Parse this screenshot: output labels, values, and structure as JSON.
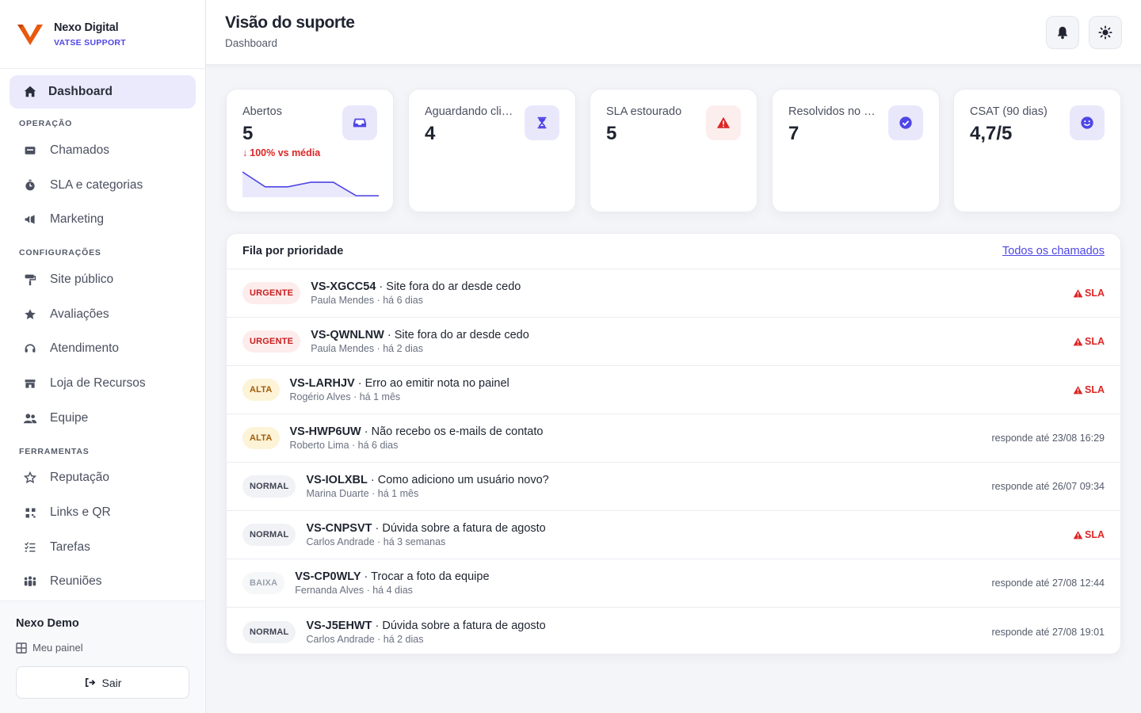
{
  "brand": {
    "name": "Nexo Digital",
    "subtitle": "VATSE SUPPORT",
    "logo_color": "#e8590c"
  },
  "sidebar": {
    "dashboard_label": "Dashboard",
    "sections": {
      "operacao": "OPERAÇÃO",
      "configuracoes": "CONFIGURAÇÕES",
      "ferramentas": "FERRAMENTAS"
    },
    "items": {
      "chamados": "Chamados",
      "sla": "SLA e categorias",
      "marketing": "Marketing",
      "site": "Site público",
      "avaliacoes": "Avaliações",
      "atendimento": "Atendimento",
      "loja": "Loja de Recursos",
      "equipe": "Equipe",
      "reputacao": "Reputação",
      "links": "Links e QR",
      "tarefas": "Tarefas",
      "reunioes": "Reuniões"
    },
    "footer": {
      "user_name": "Nexo Demo",
      "my_panel": "Meu painel",
      "logout": "Sair"
    }
  },
  "header": {
    "title": "Visão do suporte",
    "breadcrumb": "Dashboard"
  },
  "stats": [
    {
      "label": "Abertos",
      "value": "5",
      "trend": "100% vs média",
      "icon": "inbox-icon"
    },
    {
      "label": "Aguardando cliente",
      "value": "4",
      "icon": "hourglass-icon"
    },
    {
      "label": "SLA estourado",
      "value": "5",
      "icon": "warning-icon"
    },
    {
      "label": "Resolvidos no período",
      "value": "7",
      "icon": "check-circle-icon"
    },
    {
      "label": "CSAT (90 dias)",
      "value": "4,7/5",
      "icon": "smile-icon"
    }
  ],
  "sparkline": {
    "values": [
      3,
      2,
      2,
      2.3,
      2.3,
      1.4,
      1.4
    ]
  },
  "colors": {
    "accent": "#4f46e5",
    "danger": "#dc2626",
    "urgent_bg": "#fdecec",
    "high_bg": "#fdf3d7"
  },
  "queue": {
    "title": "Fila por prioridade",
    "all_link": "Todos os chamados",
    "rows": [
      {
        "priority": "URGENTE",
        "code": "VS-XGCC54",
        "subject": "Site fora do ar desde cedo",
        "meta": "Paula Mendes · há 6 dias",
        "right": "SLA",
        "sla": true
      },
      {
        "priority": "URGENTE",
        "code": "VS-QWNLNW",
        "subject": "Site fora do ar desde cedo",
        "meta": "Paula Mendes · há 2 dias",
        "right": "SLA",
        "sla": true
      },
      {
        "priority": "ALTA",
        "code": "VS-LARHJV",
        "subject": "Erro ao emitir nota no painel",
        "meta": "Rogério Alves · há 1 mês",
        "right": "SLA",
        "sla": true
      },
      {
        "priority": "ALTA",
        "code": "VS-HWP6UW",
        "subject": "Não recebo os e-mails de contato",
        "meta": "Roberto Lima · há 6 dias",
        "right": "responde até 23/08 16:29",
        "sla": false
      },
      {
        "priority": "NORMAL",
        "code": "VS-IOLXBL",
        "subject": "Como adiciono um usuário novo?",
        "meta": "Marina Duarte · há 1 mês",
        "right": "responde até 26/07 09:34",
        "sla": false
      },
      {
        "priority": "NORMAL",
        "code": "VS-CNPSVT",
        "subject": "Dúvida sobre a fatura de agosto",
        "meta": "Carlos Andrade · há 3 semanas",
        "right": "SLA",
        "sla": true
      },
      {
        "priority": "BAIXA",
        "code": "VS-CP0WLY",
        "subject": "Trocar a foto da equipe",
        "meta": "Fernanda Alves · há 4 dias",
        "right": "responde até 27/08 12:44",
        "sla": false
      },
      {
        "priority": "NORMAL",
        "code": "VS-J5EHWT",
        "subject": "Dúvida sobre a fatura de agosto",
        "meta": "Carlos Andrade · há 2 dias",
        "right": "responde até 27/08 19:01",
        "sla": false
      }
    ]
  }
}
